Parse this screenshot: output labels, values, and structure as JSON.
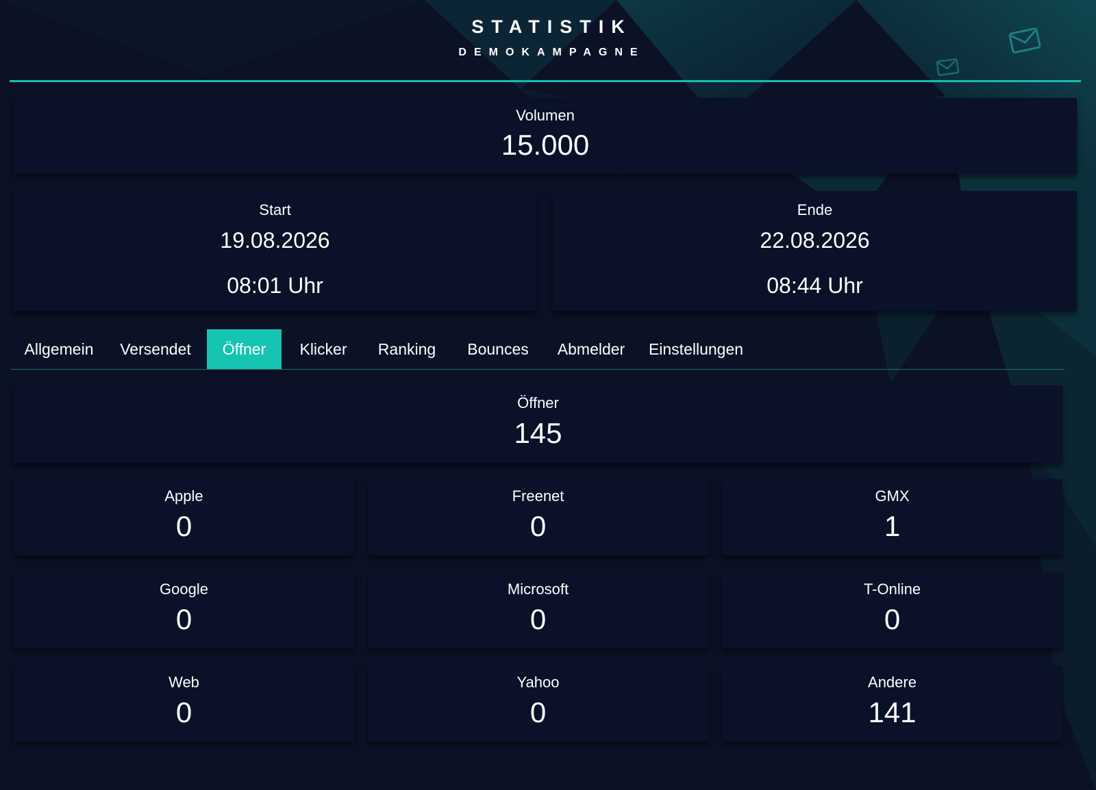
{
  "header": {
    "title": "STATISTIK",
    "subtitle": "DEMOKAMPAGNE"
  },
  "volume": {
    "label": "Volumen",
    "value": "15.000"
  },
  "start": {
    "label": "Start",
    "date": "19.08.2026",
    "time": "08:01 Uhr"
  },
  "end": {
    "label": "Ende",
    "date": "22.08.2026",
    "time": "08:44 Uhr"
  },
  "tabs": [
    {
      "label": "Allgemein",
      "active": false
    },
    {
      "label": "Versendet",
      "active": false
    },
    {
      "label": "Öffner",
      "active": true
    },
    {
      "label": "Klicker",
      "active": false
    },
    {
      "label": "Ranking",
      "active": false
    },
    {
      "label": "Bounces",
      "active": false
    },
    {
      "label": "Abmelder",
      "active": false
    },
    {
      "label": "Einstellungen",
      "active": false
    }
  ],
  "openers_total": {
    "label": "Öffner",
    "value": "145"
  },
  "providers": [
    {
      "label": "Apple",
      "value": "0"
    },
    {
      "label": "Freenet",
      "value": "0"
    },
    {
      "label": "GMX",
      "value": "1"
    },
    {
      "label": "Google",
      "value": "0"
    },
    {
      "label": "Microsoft",
      "value": "0"
    },
    {
      "label": "T-Online",
      "value": "0"
    },
    {
      "label": "Web",
      "value": "0"
    },
    {
      "label": "Yahoo",
      "value": "0"
    },
    {
      "label": "Andere",
      "value": "141"
    }
  ],
  "colors": {
    "accent": "#15c4b1",
    "background": "#0b1226",
    "card": "#0b1128"
  },
  "icons": [
    "mail-icon"
  ]
}
